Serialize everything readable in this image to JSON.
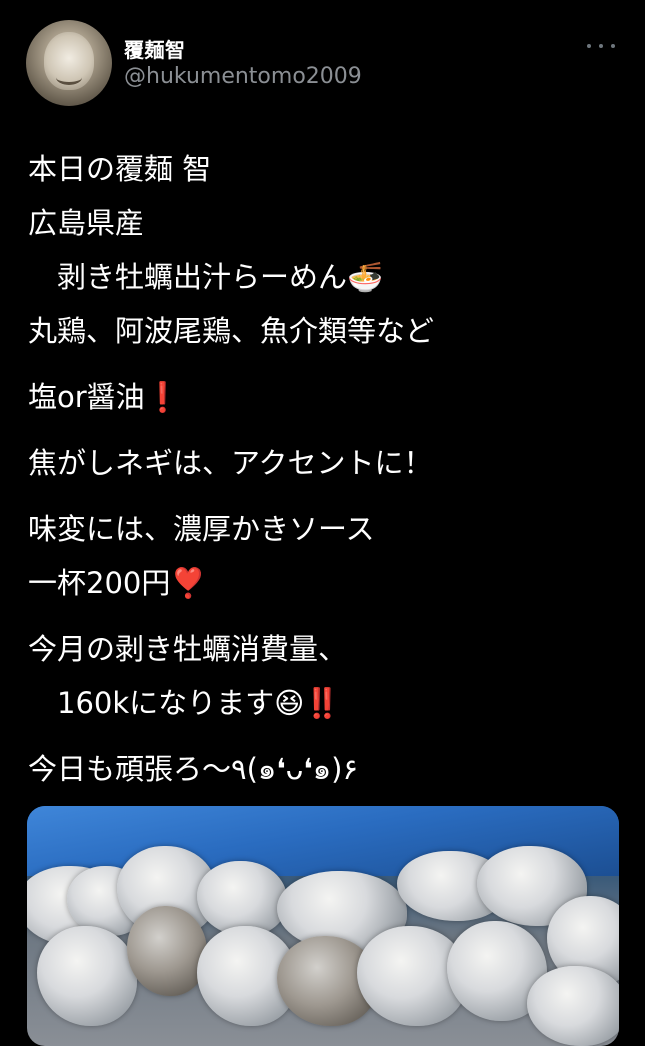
{
  "profile": {
    "display_name": "覆麺智",
    "handle": "@hukumentomo2009",
    "avatar_icon": "avatar-icon"
  },
  "menu": {
    "more_icon": "more-horizontal-icon"
  },
  "tweet": {
    "lines": [
      "本日の覆麺 智",
      "広島県産",
      "　剥き牡蠣出汁らーめん🍜",
      "丸鶏、阿波尾鶏、魚介類等など",
      "塩or醤油❗️",
      "焦がしネギは、アクセントに！",
      "味変には、濃厚かきソース",
      "一杯200円❣️",
      "今月の剥き牡蠣消費量、",
      "　160kになります😆‼️",
      "今日も頑張ろ〜٩(๑❛ᴗ❛๑)۶"
    ]
  },
  "media": {
    "image_icon": "photo-icon",
    "colors": {
      "tarp": "#2a6cc0",
      "oyster": "#d8dadd"
    }
  }
}
